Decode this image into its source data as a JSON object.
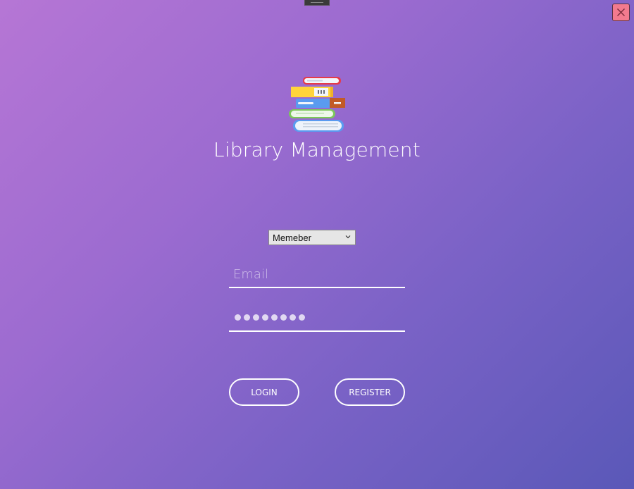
{
  "app": {
    "title": "Library Management"
  },
  "login_form": {
    "role_select": {
      "selected": "Memeber"
    },
    "email": {
      "placeholder": "Email",
      "value": ""
    },
    "password": {
      "masked_length": 8
    },
    "login_label": "LOGIN",
    "register_label": "REGISTER"
  },
  "icons": {
    "logo": "book-stack-icon",
    "close": "close-icon",
    "dropdown": "chevron-down-icon"
  },
  "colors": {
    "background_start": "#b676d5",
    "background_end": "#5a58b8",
    "close_button": "#f27a8e",
    "text": "#ffffff"
  }
}
